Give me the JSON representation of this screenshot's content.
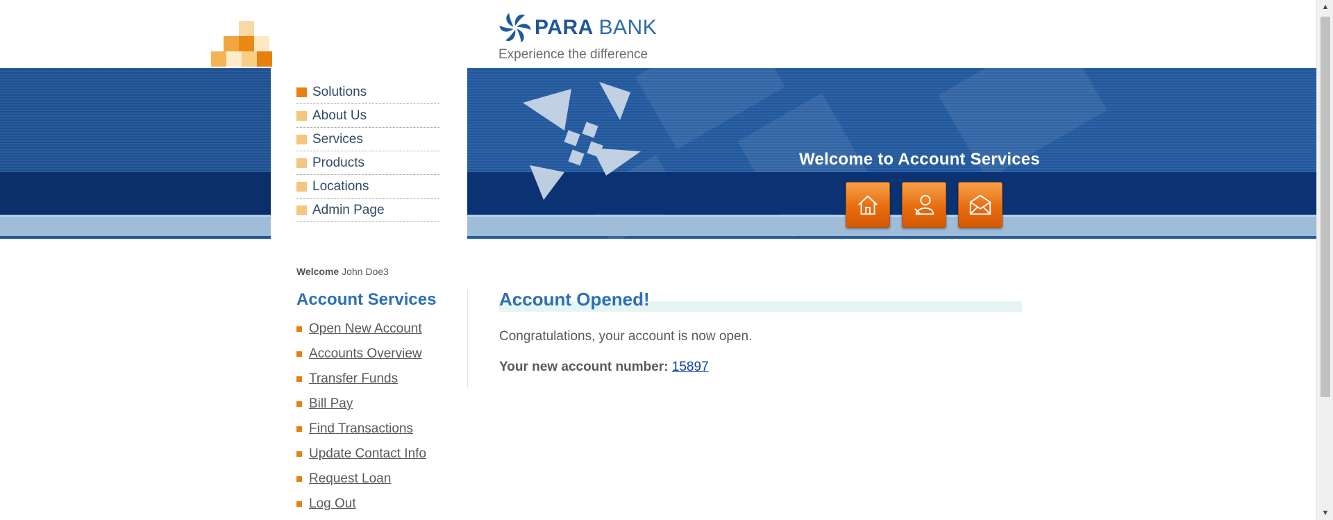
{
  "brand": {
    "logo_bold": "PARA",
    "logo_thin": "BANK",
    "tagline": "Experience the difference"
  },
  "top_menu": {
    "items": [
      {
        "label": "Solutions",
        "active": true
      },
      {
        "label": "About Us",
        "active": false
      },
      {
        "label": "Services",
        "active": false
      },
      {
        "label": "Products",
        "active": false
      },
      {
        "label": "Locations",
        "active": false
      },
      {
        "label": "Admin Page",
        "active": false
      }
    ]
  },
  "banner": {
    "heading": "Welcome to Account Services",
    "icons": [
      "home-icon",
      "contact-icon",
      "email-icon"
    ]
  },
  "welcome": {
    "prefix": "Welcome",
    "user": "John Doe3"
  },
  "account_services": {
    "title": "Account Services",
    "links": [
      "Open New Account",
      "Accounts Overview",
      "Transfer Funds",
      "Bill Pay",
      "Find Transactions",
      "Update Contact Info",
      "Request Loan",
      "Log Out"
    ]
  },
  "main": {
    "title": "Account Opened!",
    "message": "Congratulations, your account is now open.",
    "account_label": "Your new account number:",
    "account_number": "15897"
  },
  "colors": {
    "accent_orange": "#e87f10",
    "brand_blue": "#2d6fb4",
    "banner_blue": "#23569a"
  }
}
